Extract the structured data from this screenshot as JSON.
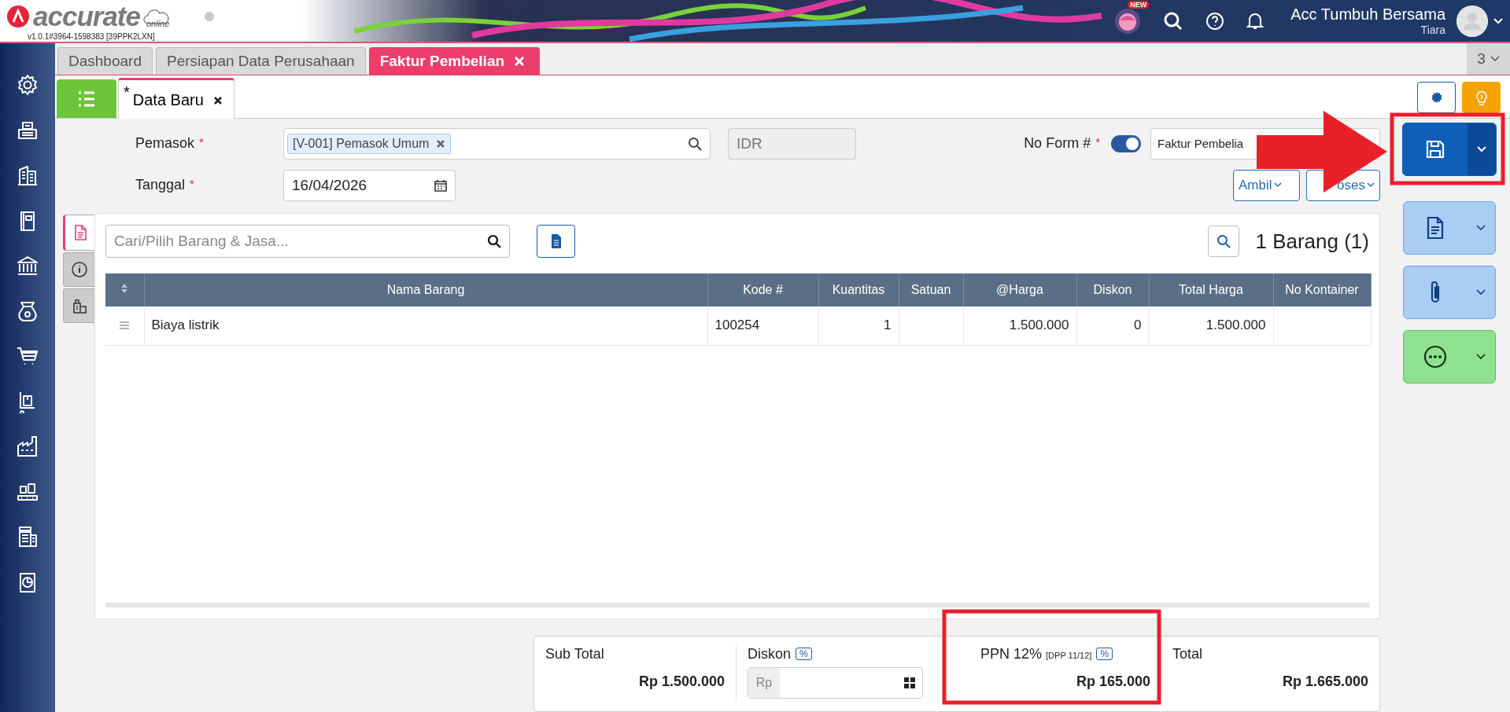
{
  "header": {
    "logo": "accurate",
    "logo_sub": "online",
    "version": "v1.0.1#3964-1598383 [39PPK2LXN]",
    "new_badge": "NEW",
    "company": "Acc Tumbuh Bersama",
    "user": "Tiara"
  },
  "tabs": [
    {
      "label": "Dashboard",
      "selected": false
    },
    {
      "label": "Persiapan Data Perusahaan",
      "selected": false
    },
    {
      "label": "Faktur Pembelian",
      "selected": true
    }
  ],
  "tab_count": "3",
  "sub_tabs": [
    {
      "prefix": "*",
      "label": "Data Baru",
      "selected": true
    }
  ],
  "form": {
    "supplier": {
      "label": "Pemasok",
      "required_mark": "*",
      "tag": "[V-001] Pemasok Umum"
    },
    "currency": "IDR",
    "date": {
      "label": "Tanggal",
      "required_mark": "*",
      "value": "16/04/2026"
    },
    "form_no": {
      "label": "No Form #",
      "required_mark": "*",
      "auto": true,
      "type": "Faktur Pembelia"
    },
    "buttons": [
      "Ambil",
      "oses"
    ]
  },
  "items_panel": {
    "side_tabs": [
      {
        "selected": true
      },
      {
        "selected": false
      },
      {
        "selected": false
      }
    ],
    "search_placeholder": "Cari/Pilih Barang & Jasa...",
    "count": "1 Barang (1)"
  },
  "table": {
    "columns": [
      "Nama Barang",
      "Kode #",
      "Kuantitas",
      "Satuan",
      "@Harga",
      "Diskon",
      "Total Harga",
      "No Kontainer"
    ],
    "rows": [
      {
        "nama": "Biaya listrik",
        "kode": "100254",
        "kuantitas": "1",
        "harga": "1.500.000",
        "diskon": "0",
        "total": "1.500.000"
      }
    ]
  },
  "totals": {
    "sub_total_label": "Sub Total",
    "sub_total": "Rp 1.500.000",
    "discount_label": "Diskon",
    "discount_pct": "%",
    "discount_prefix": "Rp",
    "tax_label": "PPN 12%",
    "tax_note": "[DPP 11/12]",
    "tax_pct": "%",
    "tax": "Rp 165.000",
    "total_label": "Total",
    "total": "Rp 1.665.000"
  }
}
